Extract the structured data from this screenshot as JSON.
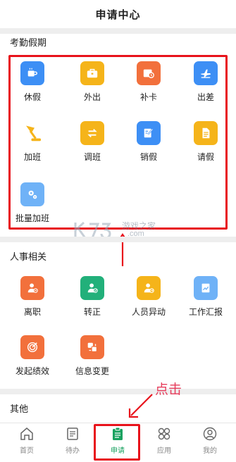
{
  "header": {
    "title": "申请中心"
  },
  "attendance": {
    "title": "考勤假期",
    "items": [
      {
        "label": "休假",
        "color": "#3d8ff5",
        "icon": "coffee-icon"
      },
      {
        "label": "外出",
        "color": "#f5b41a",
        "icon": "briefcase-icon"
      },
      {
        "label": "补卡",
        "color": "#f2703c",
        "icon": "calendar-clock-icon"
      },
      {
        "label": "出差",
        "color": "#3d8ff5",
        "icon": "airplane-icon"
      },
      {
        "label": "加班",
        "color": "#f5b41a",
        "icon": "desk-lamp-icon"
      },
      {
        "label": "调班",
        "color": "#f5b41a",
        "icon": "swap-icon"
      },
      {
        "label": "销假",
        "color": "#3d8ff5",
        "icon": "edit-note-icon"
      },
      {
        "label": "请假",
        "color": "#f5b41a",
        "icon": "document-icon"
      },
      {
        "label": "批量加班",
        "color": "#6fb2f7",
        "icon": "gears-icon"
      }
    ]
  },
  "hr": {
    "title": "人事相关",
    "items": [
      {
        "label": "离职",
        "color": "#f2703c",
        "icon": "user-remove-icon"
      },
      {
        "label": "转正",
        "color": "#22b07a",
        "icon": "user-check-icon"
      },
      {
        "label": "人员异动",
        "color": "#f5b41a",
        "icon": "user-transfer-icon"
      },
      {
        "label": "工作汇报",
        "color": "#6fb2f7",
        "icon": "report-chart-icon"
      },
      {
        "label": "发起绩效",
        "color": "#f2703c",
        "icon": "target-icon"
      },
      {
        "label": "信息变更",
        "color": "#f2703c",
        "icon": "info-change-icon"
      }
    ]
  },
  "other": {
    "title": "其他"
  },
  "watermark": {
    "text": "游戏之家",
    "sub": ".com",
    "brand": "K73"
  },
  "callout": {
    "text": "点击"
  },
  "tabbar": {
    "tabs": [
      {
        "label": "首页",
        "icon": "home-icon",
        "active": false
      },
      {
        "label": "待办",
        "icon": "todo-list-icon",
        "active": false
      },
      {
        "label": "申请",
        "icon": "clipboard-icon",
        "active": true
      },
      {
        "label": "应用",
        "icon": "apps-icon",
        "active": false
      },
      {
        "label": "我的",
        "icon": "profile-icon",
        "active": false
      }
    ]
  },
  "colors": {
    "highlight": "#e8121b",
    "active_tab": "#1aa260",
    "callout": "#e63b5a"
  }
}
